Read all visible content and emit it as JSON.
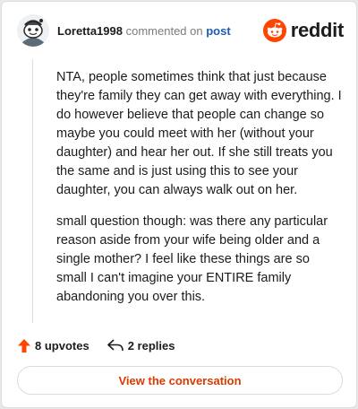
{
  "comment": {
    "username": "Loretta1998",
    "action_text": "commented on",
    "post_link_label": "post",
    "paragraphs": [
      "NTA, people sometimes think that just because they're family they can get away with everything. I do however believe that people can change so maybe you could meet with her (without your daughter) and hear her out. If she still treats you the same and is just using this to see your daughter, you can always walk out on her.",
      "small question though: was there any particular reason aside from your wife being older and a single mother? I feel like these things are so small I can't imagine your ENTIRE family abandoning you over this."
    ]
  },
  "brand": {
    "wordmark": "reddit",
    "logo_icon": "reddit-snoo-icon",
    "color": "#ff4500"
  },
  "footer": {
    "upvotes_label": "8 upvotes",
    "upvote_icon": "upvote-arrow-icon",
    "upvote_color": "#ff4500",
    "replies_label": "2 replies",
    "reply_icon": "reply-arrow-icon"
  },
  "cta": {
    "label": "View the conversation",
    "color": "#d93a00"
  }
}
